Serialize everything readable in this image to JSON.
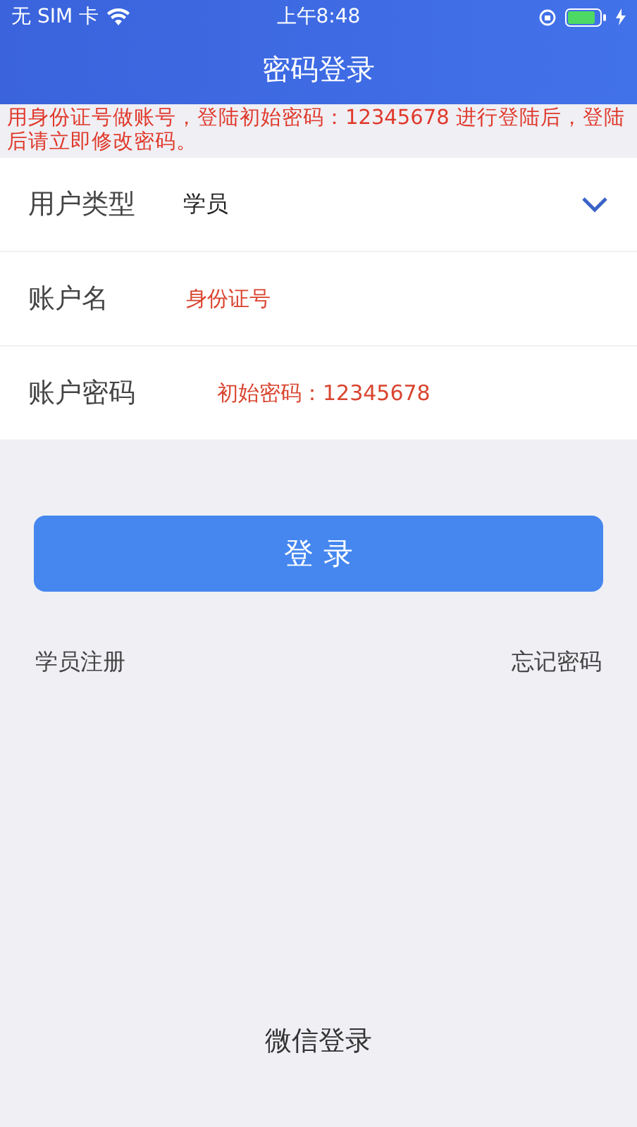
{
  "status_bar": {
    "carrier": "无 SIM 卡",
    "time": "上午8:48"
  },
  "nav": {
    "title": "密码登录"
  },
  "notice": "用身份证号做账号，登陆初始密码：12345678 进行登陆后，登陆后请立即修改密码。",
  "form": [
    {
      "kind": "select",
      "label": "用户类型",
      "value": "学员"
    },
    {
      "kind": "input",
      "label": "账户名",
      "placeholder": "身份证号"
    },
    {
      "kind": "input",
      "label": "账户密码",
      "placeholder": "初始密码：12345678"
    }
  ],
  "login_button": "登 录",
  "links": [
    "学员注册",
    "忘记密码"
  ],
  "wechat_login": "微信登录"
}
